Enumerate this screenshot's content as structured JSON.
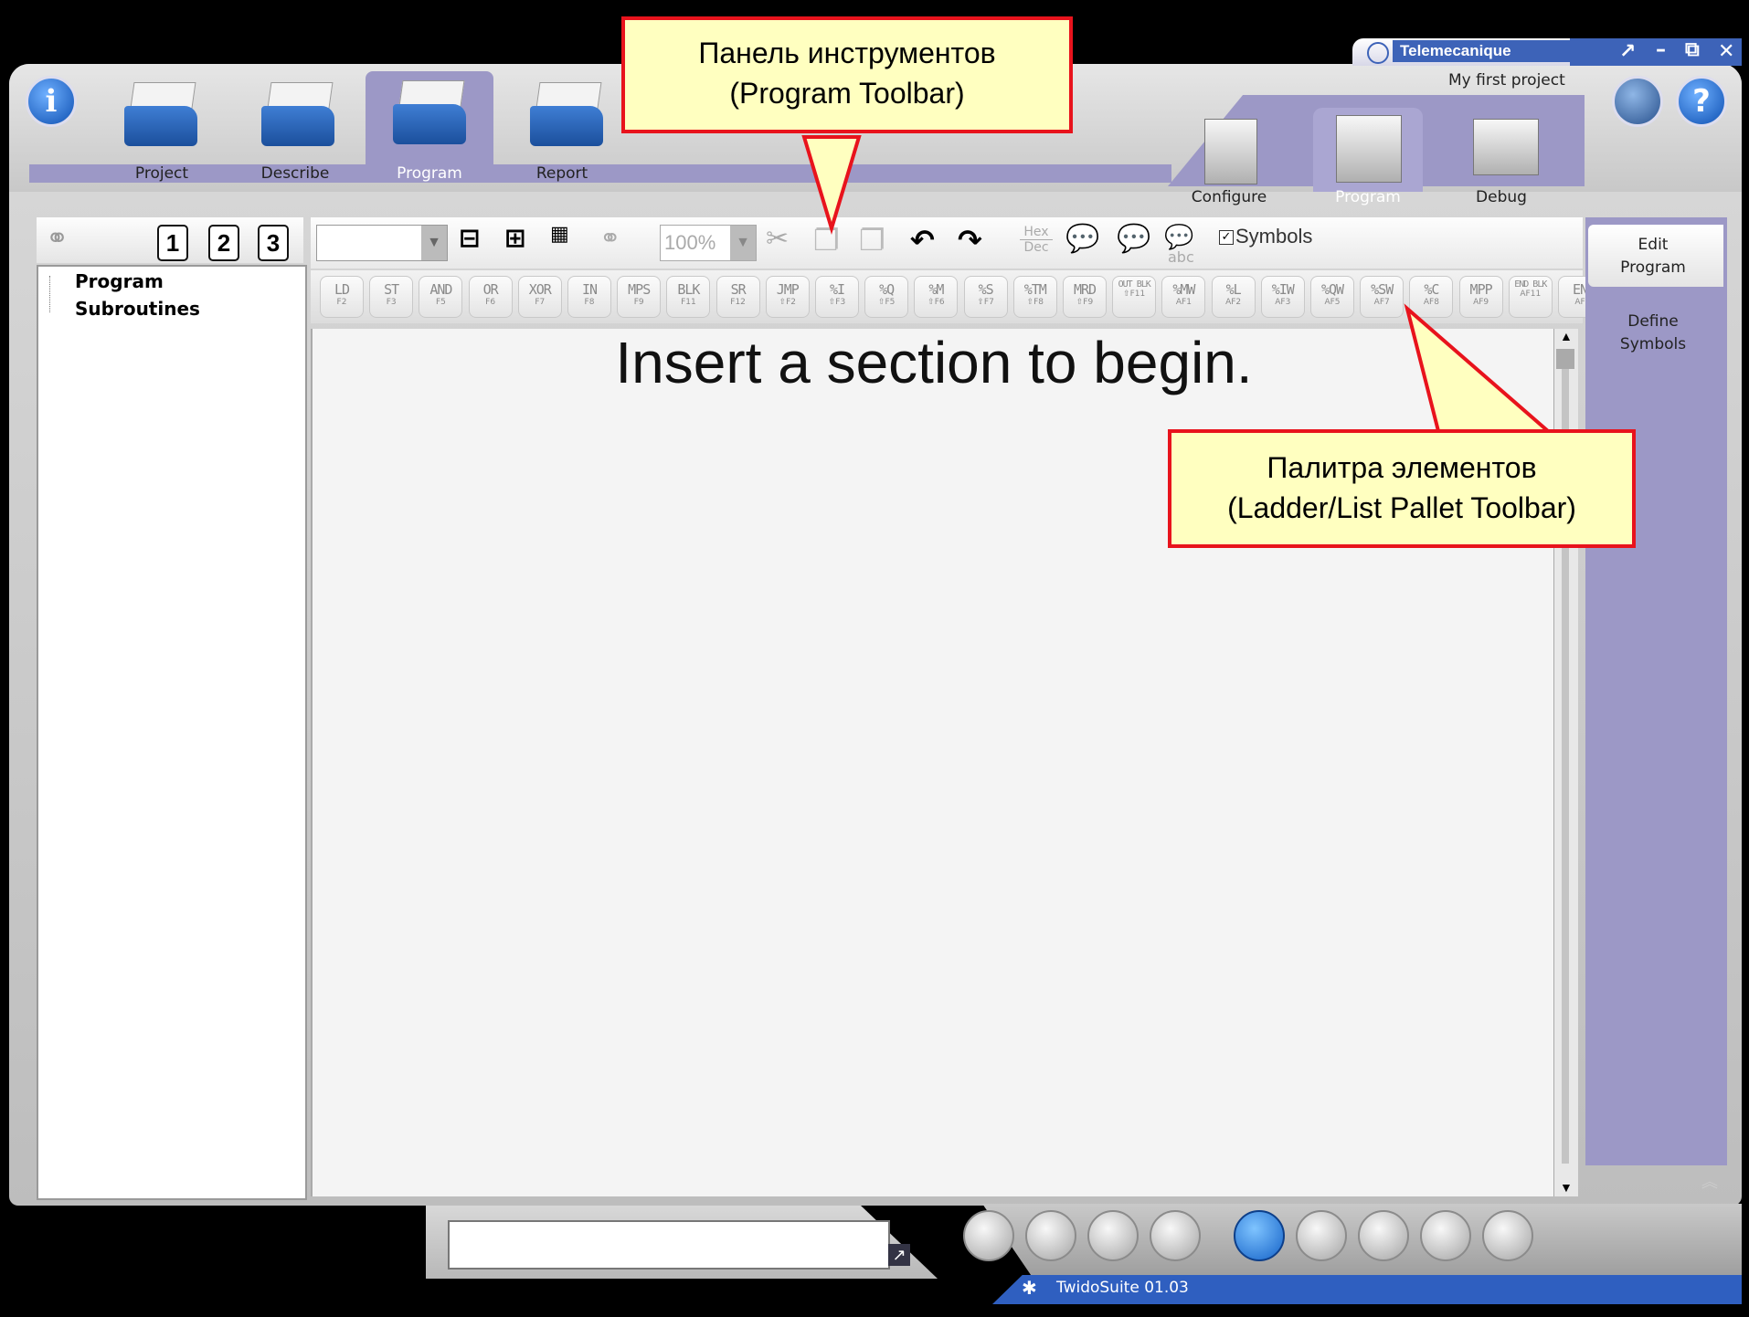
{
  "brand": {
    "name": "Telemecanique",
    "project": "My first project"
  },
  "main_tabs": [
    {
      "label": "Project"
    },
    {
      "label": "Describe"
    },
    {
      "label": "Program"
    },
    {
      "label": "Report"
    }
  ],
  "sub_tabs": [
    {
      "label": "Configure"
    },
    {
      "label": "Program"
    },
    {
      "label": "Debug"
    }
  ],
  "left_tree": {
    "items": [
      {
        "label": "Program"
      },
      {
        "label": "Subroutines"
      }
    ],
    "view_buttons": [
      "1",
      "2",
      "3"
    ]
  },
  "toolbar": {
    "zoom_value": "100%",
    "hex_label": "Hex",
    "dec_label": "Dec",
    "abc_label": "abc",
    "symbols_label": "Symbols",
    "symbols_checked": true
  },
  "palette": [
    {
      "m": "LD",
      "k": "F2"
    },
    {
      "m": "ST",
      "k": "F3"
    },
    {
      "m": "AND",
      "k": "F5"
    },
    {
      "m": "OR",
      "k": "F6"
    },
    {
      "m": "XOR",
      "k": "F7"
    },
    {
      "m": "IN",
      "k": "F8"
    },
    {
      "m": "MPS",
      "k": "F9"
    },
    {
      "m": "BLK",
      "k": "F11"
    },
    {
      "m": "SR",
      "k": "F12"
    },
    {
      "m": "JMP",
      "k": "⇧F2"
    },
    {
      "m": "%I",
      "k": "⇧F3"
    },
    {
      "m": "%Q",
      "k": "⇧F5"
    },
    {
      "m": "%M",
      "k": "⇧F6"
    },
    {
      "m": "%S",
      "k": "⇧F7"
    },
    {
      "m": "%TM",
      "k": "⇧F8"
    },
    {
      "m": "MRD",
      "k": "⇧F9"
    },
    {
      "m": "OUT BLK",
      "k": "⇧F11"
    },
    {
      "m": "%MW",
      "k": "AF1"
    },
    {
      "m": "%L",
      "k": "AF2"
    },
    {
      "m": "%IW",
      "k": "AF3"
    },
    {
      "m": "%QW",
      "k": "AF5"
    },
    {
      "m": "%SW",
      "k": "AF7"
    },
    {
      "m": "%C",
      "k": "AF8"
    },
    {
      "m": "MPP",
      "k": "AF9"
    },
    {
      "m": "END BLK",
      "k": "AF11"
    },
    {
      "m": "EN",
      "k": "AF"
    }
  ],
  "editor": {
    "message": "Insert a section to begin."
  },
  "right_pane": {
    "edit_program": "Edit\nProgram",
    "define_symbols": "Define\nSymbols"
  },
  "callouts": {
    "toolbar": "Панель инструментов\n(Program Toolbar)",
    "palette": "Палитра элементов\n(Ladder/List Pallet Toolbar)"
  },
  "status": {
    "version": "TwidoSuite 01.03",
    "input_value": ""
  },
  "colors": {
    "accent_purple": "#9c98c6",
    "callout_border": "#e8131c",
    "callout_fill": "#ffffc0"
  }
}
